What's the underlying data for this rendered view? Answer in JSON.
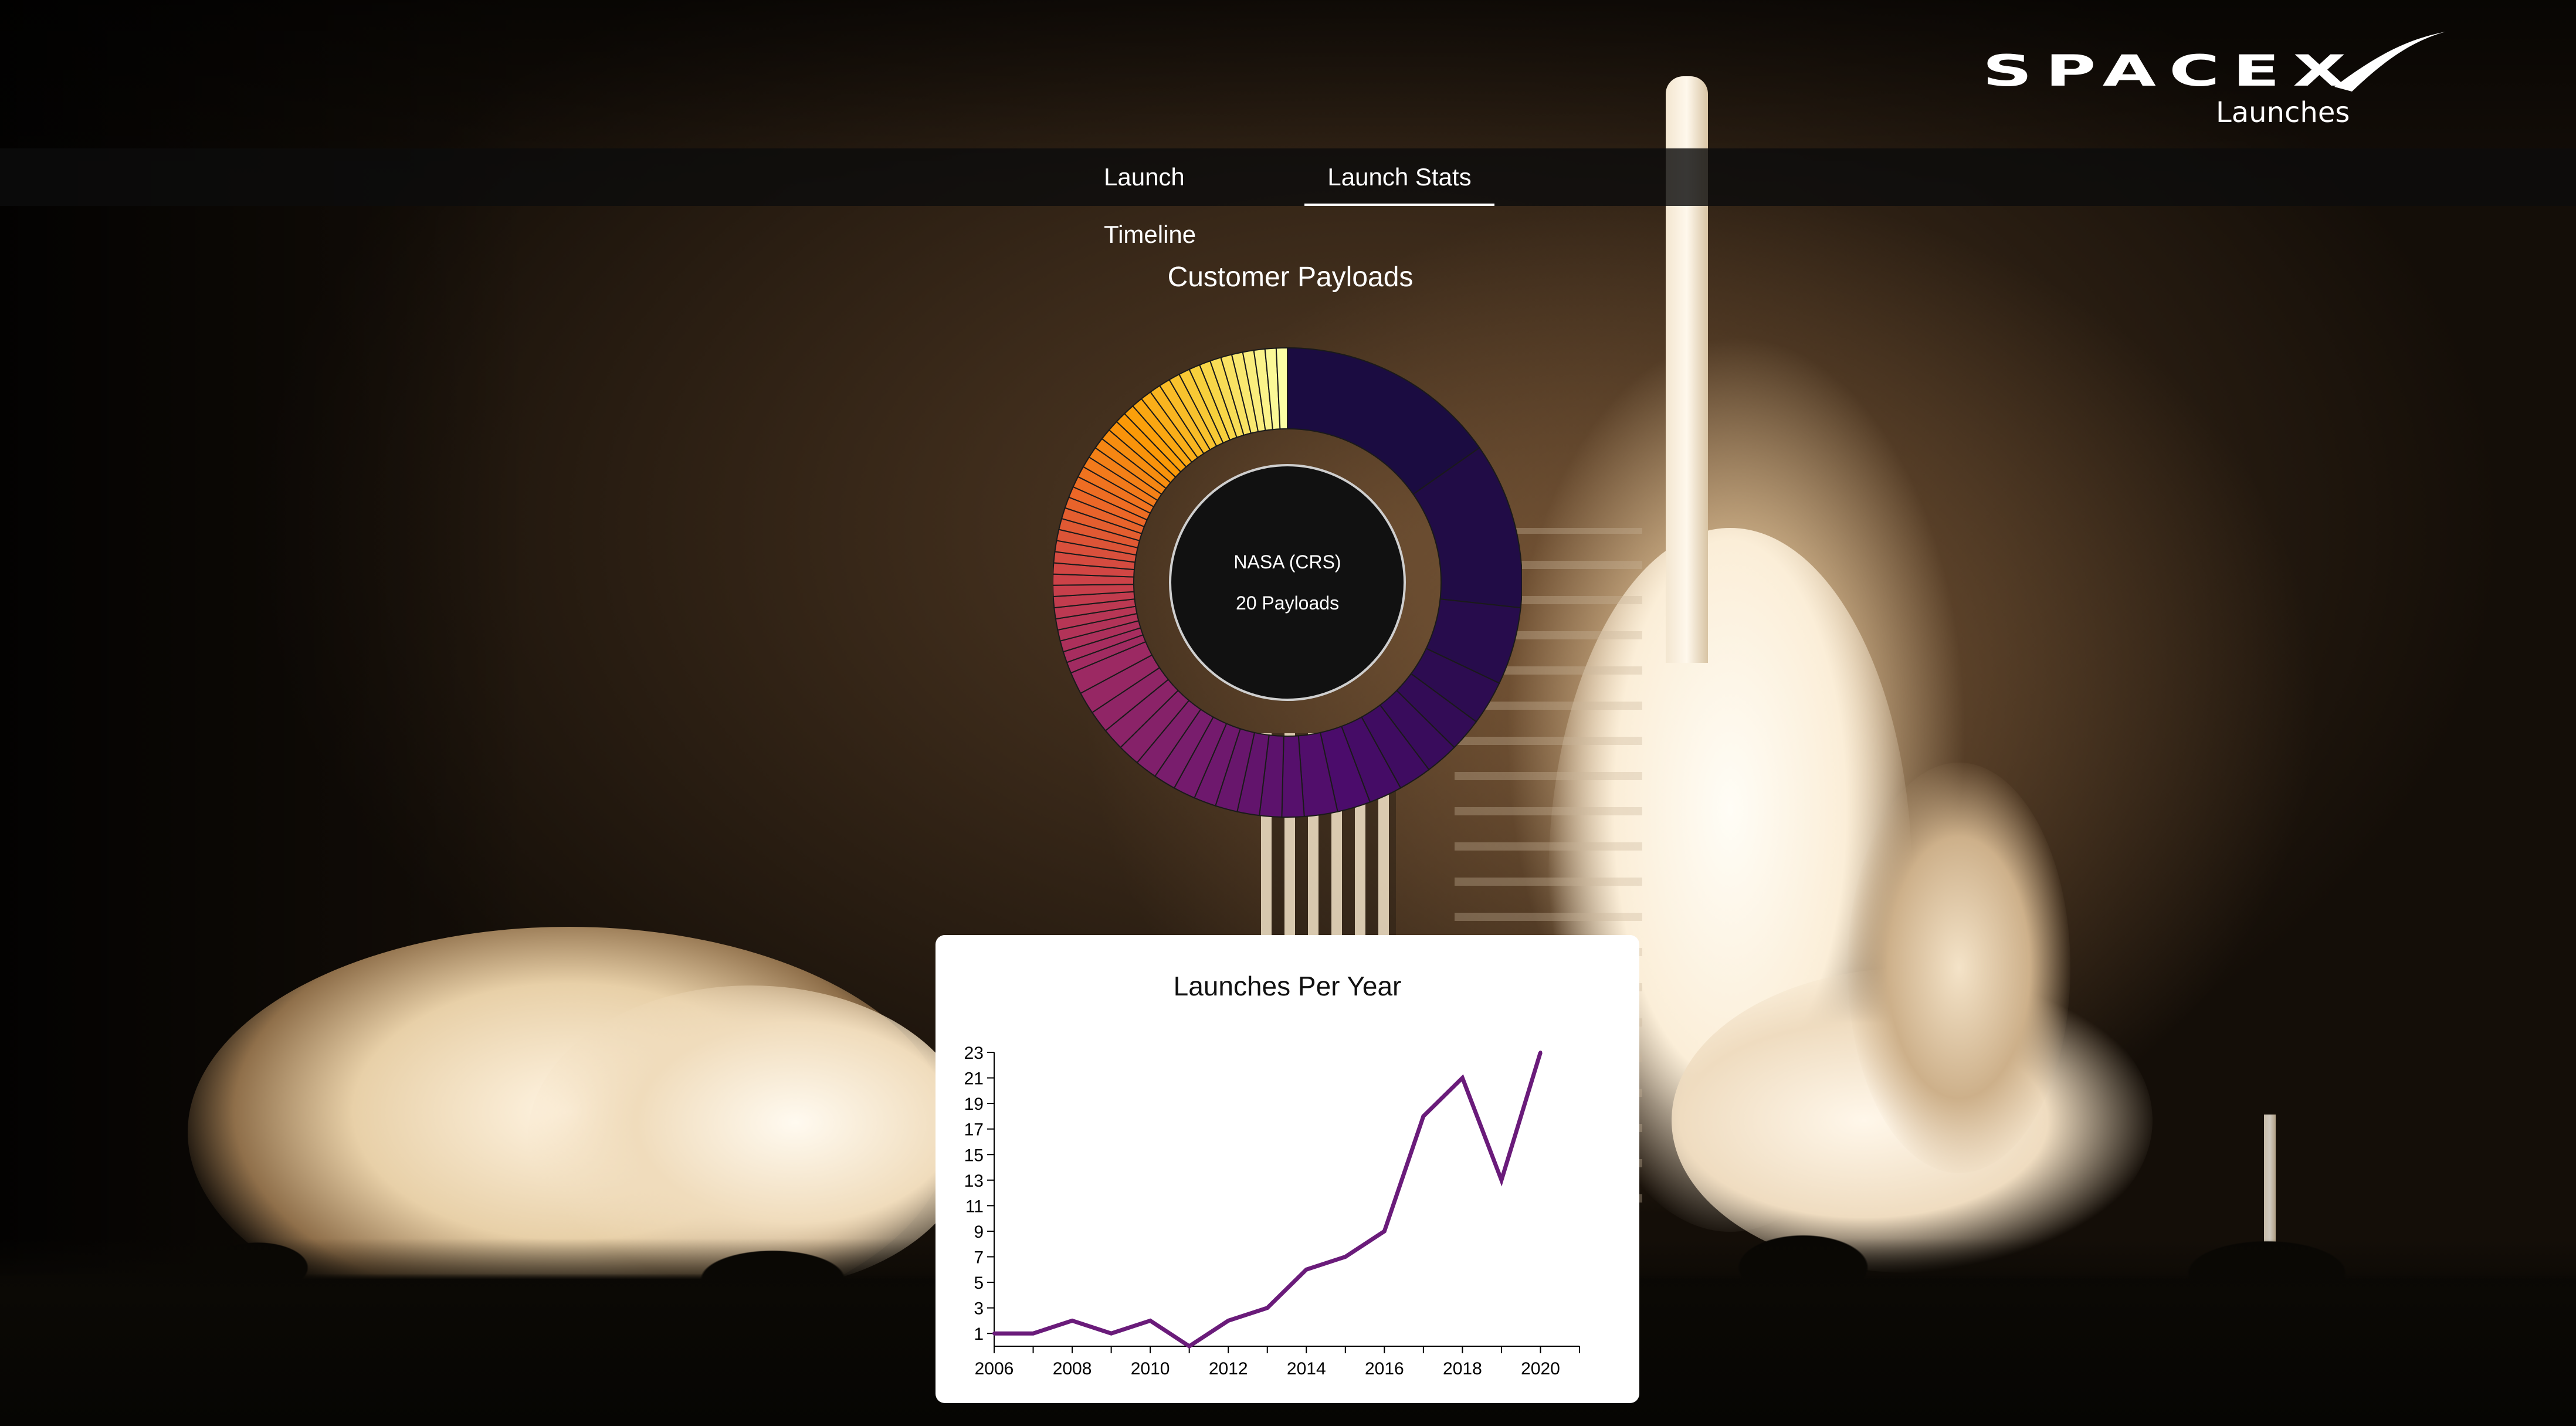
{
  "brand": {
    "name": "SPACEX",
    "subtitle": "Launches"
  },
  "nav": {
    "tabs": [
      {
        "label": "Launch Timeline",
        "active": false
      },
      {
        "label": "Launch Stats",
        "active": true
      }
    ]
  },
  "customer_payloads": {
    "title": "Customer Payloads",
    "selected": {
      "customer": "NASA (CRS)",
      "payloads": "20 Payloads"
    },
    "chart_data": {
      "type": "pie",
      "variant": "donut",
      "title": "Customer Payloads",
      "values": [
        20,
        15,
        7,
        4,
        3,
        3,
        3,
        3,
        3,
        3,
        2,
        2,
        2,
        2,
        2,
        2,
        2,
        2,
        2,
        2,
        2,
        2,
        2,
        1,
        1,
        1,
        1,
        1,
        1,
        1,
        1,
        1,
        1,
        1,
        1,
        1,
        1,
        1,
        1,
        1,
        1,
        1,
        1,
        1,
        1,
        1,
        1,
        1,
        1,
        1,
        1,
        1,
        1,
        1,
        1,
        1,
        1,
        1,
        1,
        1,
        1,
        1,
        1,
        1
      ],
      "highlighted_index": 0,
      "colormap_stops": [
        "#1b0c41",
        "#4a0c6b",
        "#781c6d",
        "#a52c60",
        "#cf4446",
        "#ed6925",
        "#fb9b06",
        "#f7d13d",
        "#fcffa4"
      ]
    }
  },
  "launches_per_year": {
    "title": "Launches Per Year",
    "chart_data": {
      "type": "line",
      "title": "Launches Per Year",
      "x": [
        2006,
        2007,
        2008,
        2009,
        2010,
        2011,
        2012,
        2013,
        2014,
        2015,
        2016,
        2017,
        2018,
        2019,
        2020
      ],
      "series": [
        {
          "values": [
            1,
            1,
            2,
            1,
            2,
            0,
            2,
            3,
            6,
            7,
            9,
            18,
            21,
            13,
            23
          ]
        }
      ],
      "xticks": [
        2006,
        2008,
        2010,
        2012,
        2014,
        2016,
        2018,
        2020
      ],
      "yticks": [
        1,
        3,
        5,
        7,
        9,
        11,
        13,
        15,
        17,
        19,
        21,
        23
      ],
      "xlim": [
        2006,
        2021
      ],
      "ylim": [
        0,
        23
      ],
      "line_color": "#6a1b7a",
      "grid": false
    }
  }
}
